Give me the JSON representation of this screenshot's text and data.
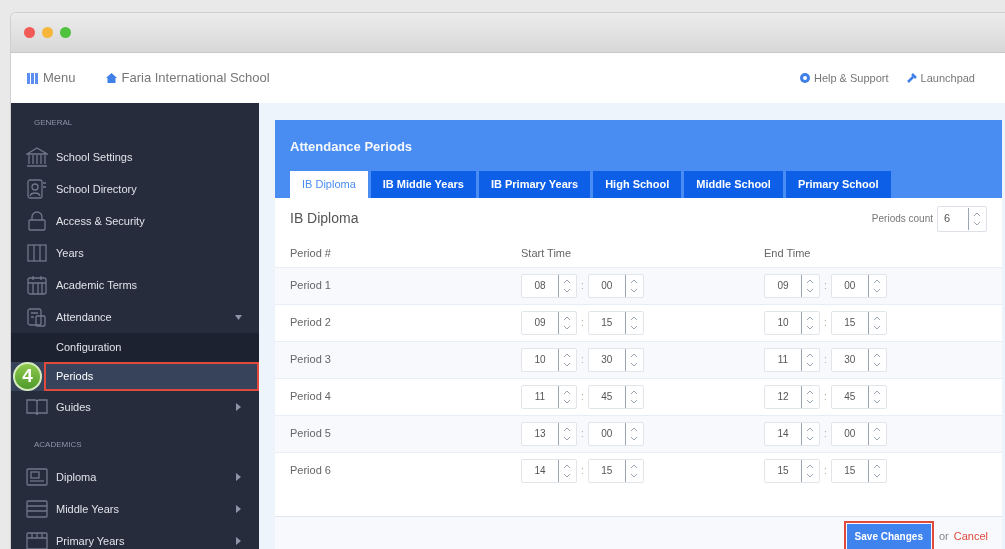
{
  "navbar": {
    "menu": "Menu",
    "school": "Faria International School",
    "links": [
      "Help & Support",
      "Launchpad"
    ]
  },
  "sidebar": {
    "sections": [
      {
        "title": "GENERAL",
        "items": [
          {
            "label": "School Settings"
          },
          {
            "label": "School Directory"
          },
          {
            "label": "Access & Security"
          },
          {
            "label": "Years"
          },
          {
            "label": "Academic Terms"
          },
          {
            "label": "Attendance",
            "expanded": true,
            "children": [
              {
                "label": "Configuration",
                "selected": false,
                "outlined": false
              },
              {
                "label": "Periods",
                "selected": true,
                "outlined": true,
                "step": "4"
              }
            ]
          },
          {
            "label": "Guides",
            "expanded": false
          }
        ]
      },
      {
        "title": "ACADEMICS",
        "items": [
          {
            "label": "Diploma",
            "expanded": false
          },
          {
            "label": "Middle Years",
            "expanded": false
          },
          {
            "label": "Primary Years",
            "expanded": false
          }
        ]
      }
    ]
  },
  "panel": {
    "title": "Attendance Periods",
    "tabs": [
      {
        "label": "IB Diploma",
        "selected": true
      },
      {
        "label": "IB Middle Years",
        "selected": false
      },
      {
        "label": "IB Primary Years",
        "selected": false
      },
      {
        "label": "High School",
        "selected": false
      },
      {
        "label": "Middle School",
        "selected": false
      },
      {
        "label": "Primary School",
        "selected": false
      }
    ],
    "heading": "IB Diploma",
    "periods_count": {
      "label": "Periods count",
      "value": "6"
    },
    "columns": [
      "Period #",
      "Start Time",
      "End Time"
    ],
    "rows": [
      {
        "label": "Period 1",
        "start": [
          "08",
          ":",
          "00"
        ],
        "end": [
          "09",
          ":",
          "00"
        ]
      },
      {
        "label": "Period 2",
        "start": [
          "09",
          ":",
          "15"
        ],
        "end": [
          "10",
          ":",
          "15"
        ]
      },
      {
        "label": "Period 3",
        "start": [
          "10",
          ":",
          "30"
        ],
        "end": [
          "11",
          ":",
          "30"
        ]
      },
      {
        "label": "Period 4",
        "start": [
          "11",
          ":",
          "45"
        ],
        "end": [
          "12",
          ":",
          "45"
        ]
      },
      {
        "label": "Period 5",
        "start": [
          "13",
          ":",
          "00"
        ],
        "end": [
          "14",
          ":",
          "00"
        ]
      },
      {
        "label": "Period 6",
        "start": [
          "14",
          ":",
          "15"
        ],
        "end": [
          "15",
          ":",
          "15"
        ]
      }
    ],
    "save": {
      "label": "Save Changes",
      "outlined": true
    },
    "or": "or",
    "cancel": "Cancel"
  }
}
